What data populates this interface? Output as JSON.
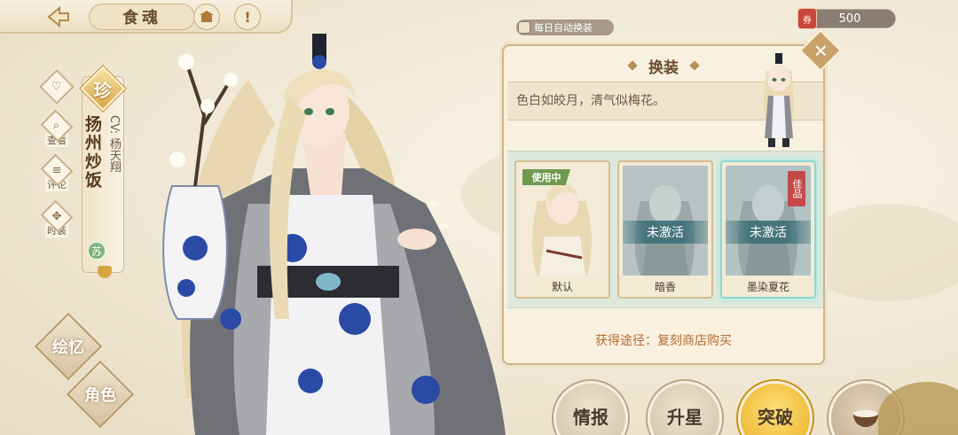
{
  "header": {
    "title": "食魂",
    "currency_value": "500",
    "currency_icon": "ticket-icon"
  },
  "sidebar": {
    "items": [
      {
        "label": "",
        "icon": "heart-icon"
      },
      {
        "label": "查看",
        "icon": "magnifier-icon"
      },
      {
        "label": "评论",
        "icon": "comment-icon"
      },
      {
        "label": "时装",
        "icon": "costume-icon"
      }
    ],
    "rarity": "珍",
    "character_name": "扬州炒饭",
    "cv": "CV: 杨天翔",
    "region": "苏",
    "bottom_buttons": [
      {
        "label": "绘忆"
      },
      {
        "label": "角色"
      }
    ]
  },
  "auto_change": {
    "label": "每日自动换装",
    "checked": false
  },
  "panel": {
    "title": "换装",
    "description": "色白如皎月，清气似梅花。",
    "close_label": "✕",
    "skins": [
      {
        "name": "默认",
        "status": "使用中",
        "locked": false
      },
      {
        "name": "暗香",
        "status": "未激活",
        "locked": true
      },
      {
        "name": "墨染夏花",
        "status": "未激活",
        "locked": true,
        "quality": "佳品"
      }
    ],
    "source_text": "获得途径：复刻商店购买"
  },
  "actions": [
    {
      "label": "情报"
    },
    {
      "label": "升星"
    },
    {
      "label": "突破"
    },
    {
      "label": ""
    }
  ],
  "colors": {
    "accent_gold": "#e7ad1e",
    "using_green": "#6e9a4f",
    "locked_teal": "#3c6e76",
    "quality_red": "#c44a4a"
  }
}
